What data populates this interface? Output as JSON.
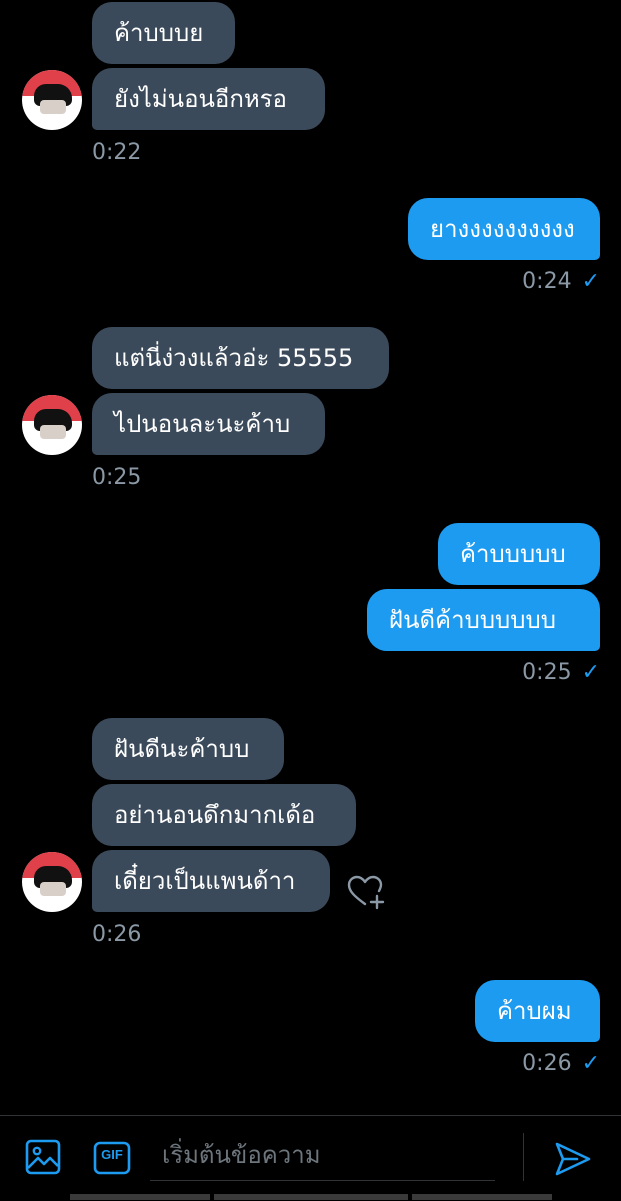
{
  "thread": {
    "groups": [
      {
        "side": "in",
        "messages": [
          "ค้าบบบย",
          "ยังไม่นอนอีกหรอ"
        ],
        "time": "0:22"
      },
      {
        "side": "out",
        "messages": [
          "ยางงงงงงงงงง"
        ],
        "time": "0:24"
      },
      {
        "side": "in",
        "messages": [
          "แต่นี่ง่วงแล้วอ่ะ 55555",
          "ไปนอนละนะค้าบ"
        ],
        "time": "0:25"
      },
      {
        "side": "out",
        "messages": [
          "ค้าบบบบบ",
          "ฝันดีค้าบบบบบบ"
        ],
        "time": "0:25"
      },
      {
        "side": "in",
        "messages": [
          "ฝันดีนะค้าบบ",
          "อย่านอนดึกมากเด้อ",
          "เดี๋ยวเป็นแพนด้าา"
        ],
        "time": "0:26"
      },
      {
        "side": "out",
        "messages": [
          "ค้าบผม"
        ],
        "time": "0:26"
      }
    ],
    "sent_icon": "check-icon",
    "react_icon": "heart-plus-icon"
  },
  "composer": {
    "placeholder": "เริ่มต้นข้อความ",
    "media_icon": "image-icon",
    "gif_label": "GIF",
    "send_icon": "send-icon"
  },
  "colors": {
    "background": "#000000",
    "incoming_bubble": "#3b4a5a",
    "outgoing_bubble": "#1d9bf0",
    "timestamp": "#8b98a5",
    "accent": "#1d9bf0"
  }
}
